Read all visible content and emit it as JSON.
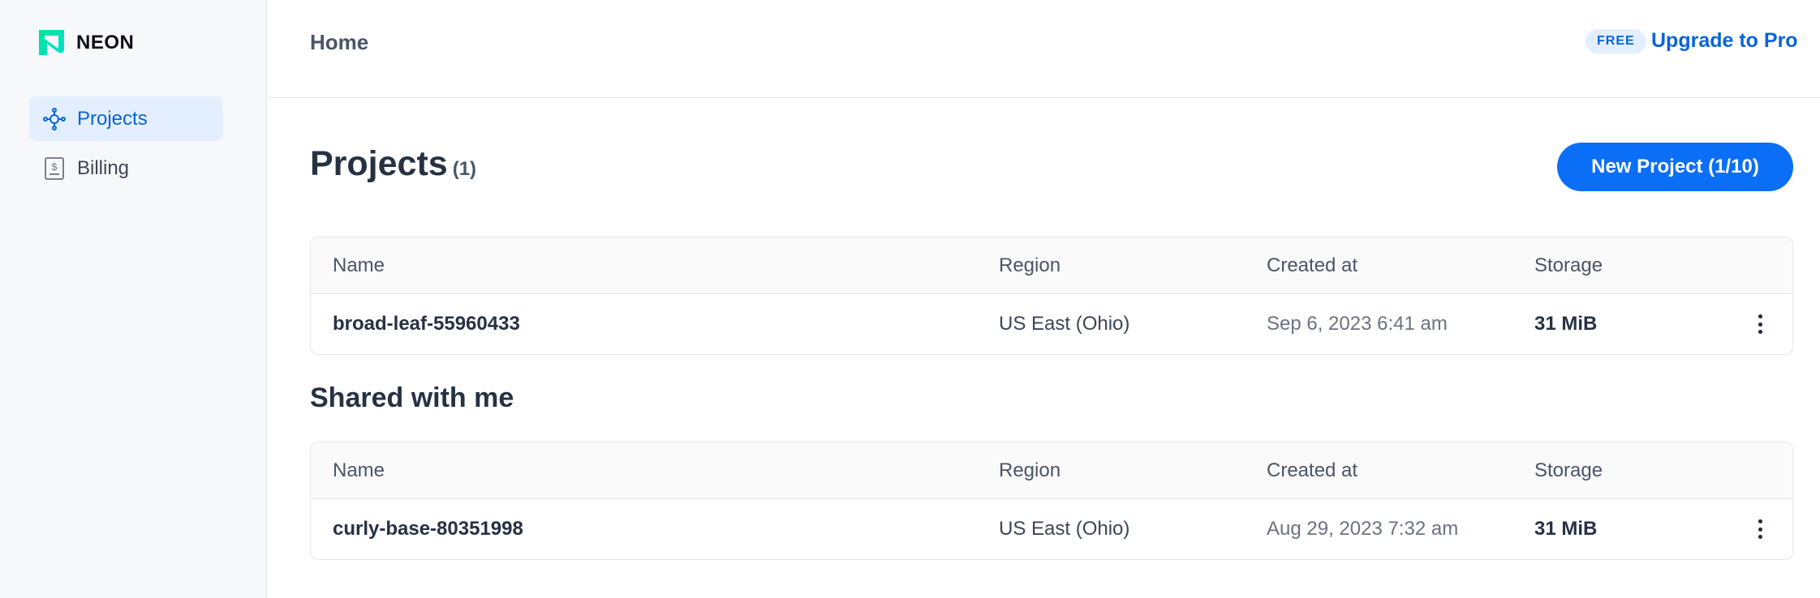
{
  "app": {
    "logo_text": "NEON",
    "brand_color": "#00e599"
  },
  "sidebar": {
    "items": [
      {
        "label": "Projects",
        "icon": "projects-icon",
        "active": true
      },
      {
        "label": "Billing",
        "icon": "billing-icon",
        "active": false
      }
    ]
  },
  "topbar": {
    "breadcrumb": "Home",
    "plan_badge": "FREE",
    "upgrade_label": "Upgrade to Pro"
  },
  "projects": {
    "title": "Projects",
    "count": "(1)",
    "new_button": "New Project (1/10)",
    "columns": [
      "Name",
      "Region",
      "Created at",
      "Storage"
    ],
    "rows": [
      {
        "name": "broad-leaf-55960433",
        "region": "US East (Ohio)",
        "created": "Sep 6, 2023 6:41 am",
        "storage": "31 MiB"
      }
    ]
  },
  "shared": {
    "title": "Shared with me",
    "columns": [
      "Name",
      "Region",
      "Created at",
      "Storage"
    ],
    "rows": [
      {
        "name": "curly-base-80351998",
        "region": "US East (Ohio)",
        "created": "Aug 29, 2023 7:32 am",
        "storage": "31 MiB"
      }
    ]
  },
  "colors": {
    "accent": "#0b6ef7",
    "link": "#0a64d8",
    "active_bg": "#e3efff"
  }
}
